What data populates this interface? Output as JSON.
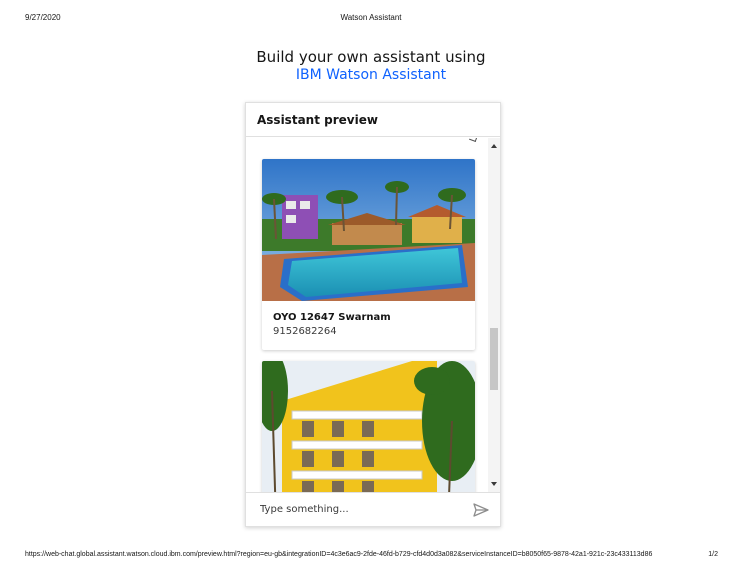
{
  "print_header": {
    "date": "9/27/2020",
    "title": "Watson Assistant"
  },
  "heading": {
    "line1": "Build your own assistant using",
    "line2": "IBM Watson Assistant",
    "accent_color": "#0f62fe"
  },
  "panel": {
    "title": "Assistant preview",
    "cards": [
      {
        "name": "OYO 12647 Swarnam",
        "phone": "9152682264",
        "image": "resort-pool-photo"
      },
      {
        "name": "",
        "phone": "",
        "image": "yellow-hotel-building-photo"
      }
    ],
    "input": {
      "placeholder": "Type something...",
      "value": ""
    },
    "send_icon": "send-icon"
  },
  "print_footer": {
    "url": "https://web-chat.global.assistant.watson.cloud.ibm.com/preview.html?region=eu-gb&integrationID=4c3e6ac9-2fde-46fd-b729-cfd4d0d3a082&serviceInstanceID=b8050f65-9878-42a1-921c-23c433113d86",
    "page": "1/2"
  }
}
